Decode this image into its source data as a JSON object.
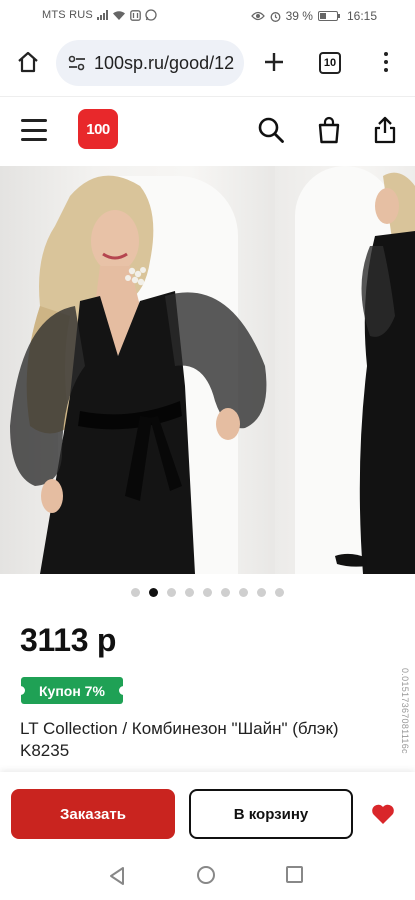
{
  "status_bar": {
    "carrier": "MTS RUS",
    "battery": "39 %",
    "battery_level": 0.39,
    "time": "16:15"
  },
  "browser": {
    "url": "100sp.ru/good/12",
    "tab_count": "10"
  },
  "site_header": {
    "logo_text": "100"
  },
  "gallery": {
    "total_images": 9,
    "active_index": 1
  },
  "product": {
    "price": "3113 р",
    "coupon": "Купон 7%",
    "title": "LT Collection / Комбинезон \"Шайн\" (блэк) K8235",
    "side_id": "0.01517367081116c"
  },
  "actions": {
    "order_label": "Заказать",
    "cart_label": "В корзину"
  },
  "colors": {
    "brand_red": "#e8282b",
    "order_button": "#c9241f",
    "coupon_green": "#1fa155",
    "favorite_heart": "#d9262a"
  }
}
